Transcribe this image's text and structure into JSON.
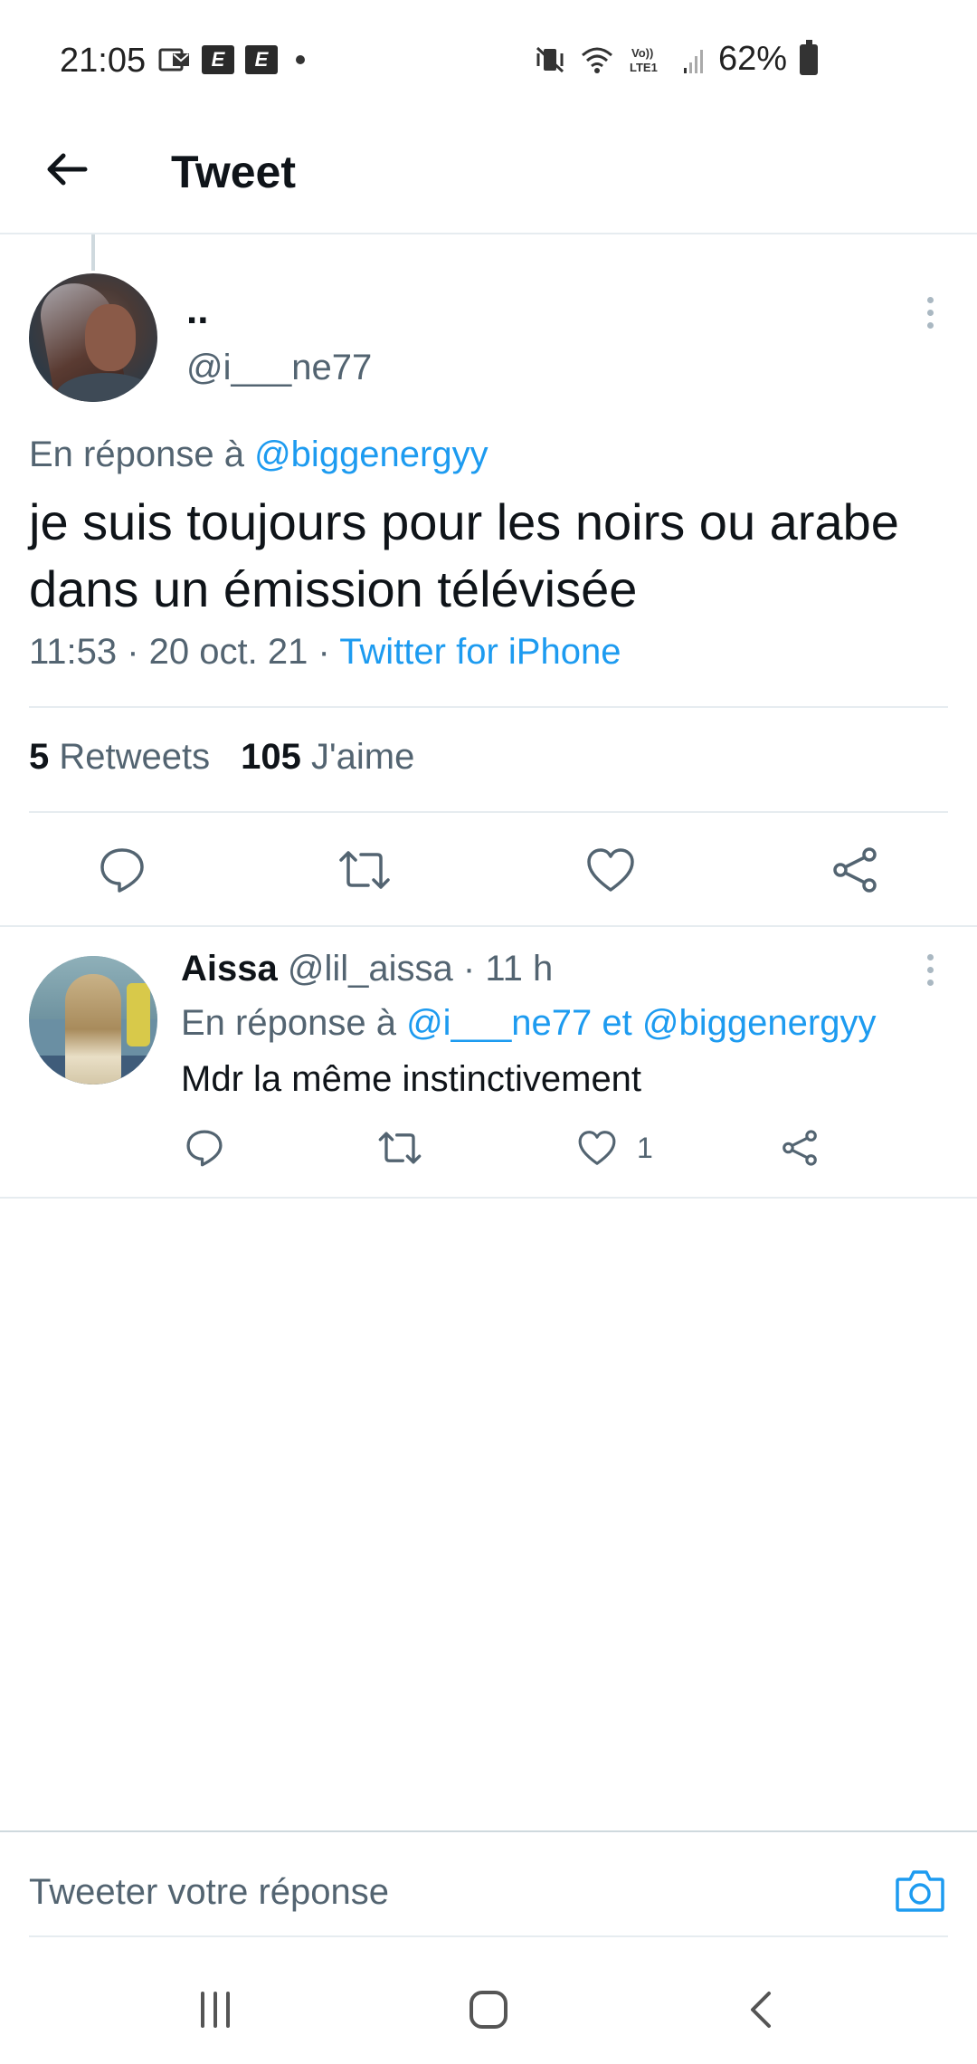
{
  "status_bar": {
    "time": "21:05",
    "notif_icons": [
      "E",
      "E"
    ],
    "battery_percent": "62%"
  },
  "header": {
    "title": "Tweet"
  },
  "main_tweet": {
    "display_name": "..",
    "handle": "@i___ne77",
    "reply_prefix": "En réponse à",
    "reply_to": "@biggenergyy",
    "text": "je suis toujours pour les noirs ou arabe dans un émission télévisée",
    "time": "11:53 · 20 oct. 21 ·",
    "source": "Twitter for iPhone",
    "retweet_count": "5",
    "retweet_label": "Retweets",
    "like_count": "105",
    "like_label": "J'aime"
  },
  "reply_tweet": {
    "display_name": "Aissa",
    "handle": "@lil_aissa",
    "time": "· 11 h",
    "reply_prefix": "En réponse à",
    "reply_to_1": "@i___ne77",
    "reply_conjunction": "et",
    "reply_to_2": "@biggenergyy",
    "text": "Mdr la même instinctivement",
    "like_count": "1"
  },
  "compose": {
    "placeholder": "Tweeter votre réponse"
  },
  "colors": {
    "accent": "#1d9bf0",
    "text": "#0f1419",
    "secondary": "#536471",
    "divider": "#e6ecf0"
  },
  "icons": {
    "back": "arrow-left-icon",
    "more": "more-vertical-icon",
    "reply": "comment-icon",
    "retweet": "retweet-icon",
    "like": "heart-icon",
    "share": "share-icon",
    "camera": "camera-icon"
  }
}
